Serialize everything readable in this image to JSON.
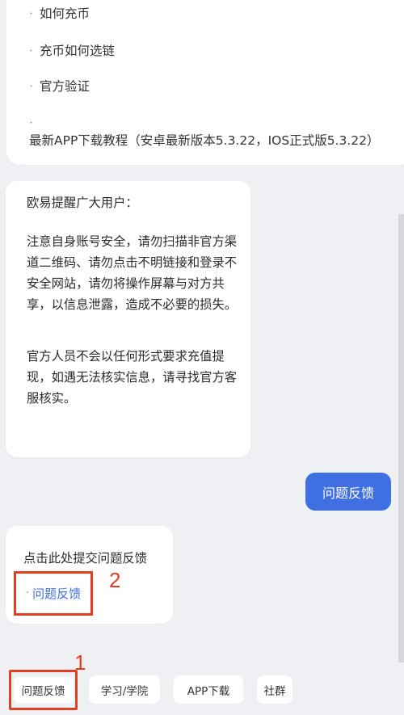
{
  "menu": {
    "items": [
      {
        "dot": "·",
        "label": "如何充币"
      },
      {
        "dot": "·",
        "label": "充币如何选链"
      },
      {
        "dot": "·",
        "label": "官方验证"
      },
      {
        "dot": "·",
        "label": "最新APP下载教程（安卓最新版本5.3.22，IOS正式版5.3.22）"
      }
    ]
  },
  "notice": {
    "greeting": "欧易提醒广大用户：",
    "para1": "注意自身账号安全，请勿扫描非官方渠道二维码、请勿点击不明链接和登录不安全网站，请勿将操作屏幕与对方共享，以信息泄露，造成不必要的损失。",
    "para2": "官方人员不会以任何形式要求充值提现，如遇无法核实信息，请寻找官方客服核实。"
  },
  "user_message": "问题反馈",
  "feedback": {
    "title": "点击此处提交问题反馈",
    "link_dot": "·",
    "link_label": "问题反馈"
  },
  "markers": {
    "one": "1",
    "two": "2"
  },
  "quick_chips": [
    "问题反馈",
    "学习/学院",
    "APP下载",
    "社群"
  ],
  "colors": {
    "accent": "#3f6fe0",
    "highlight": "#e0401f"
  }
}
